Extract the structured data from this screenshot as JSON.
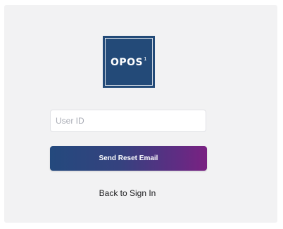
{
  "logo": {
    "text": "OPOS",
    "superscript": "1",
    "background": "#234a78"
  },
  "form": {
    "user_id_placeholder": "User ID",
    "user_id_value": "",
    "send_button_label": "Send Reset Email",
    "back_link_label": "Back to Sign In"
  },
  "colors": {
    "button_gradient_start": "#24497d",
    "button_gradient_end": "#7a2182",
    "panel_background": "#f2f2f3"
  }
}
